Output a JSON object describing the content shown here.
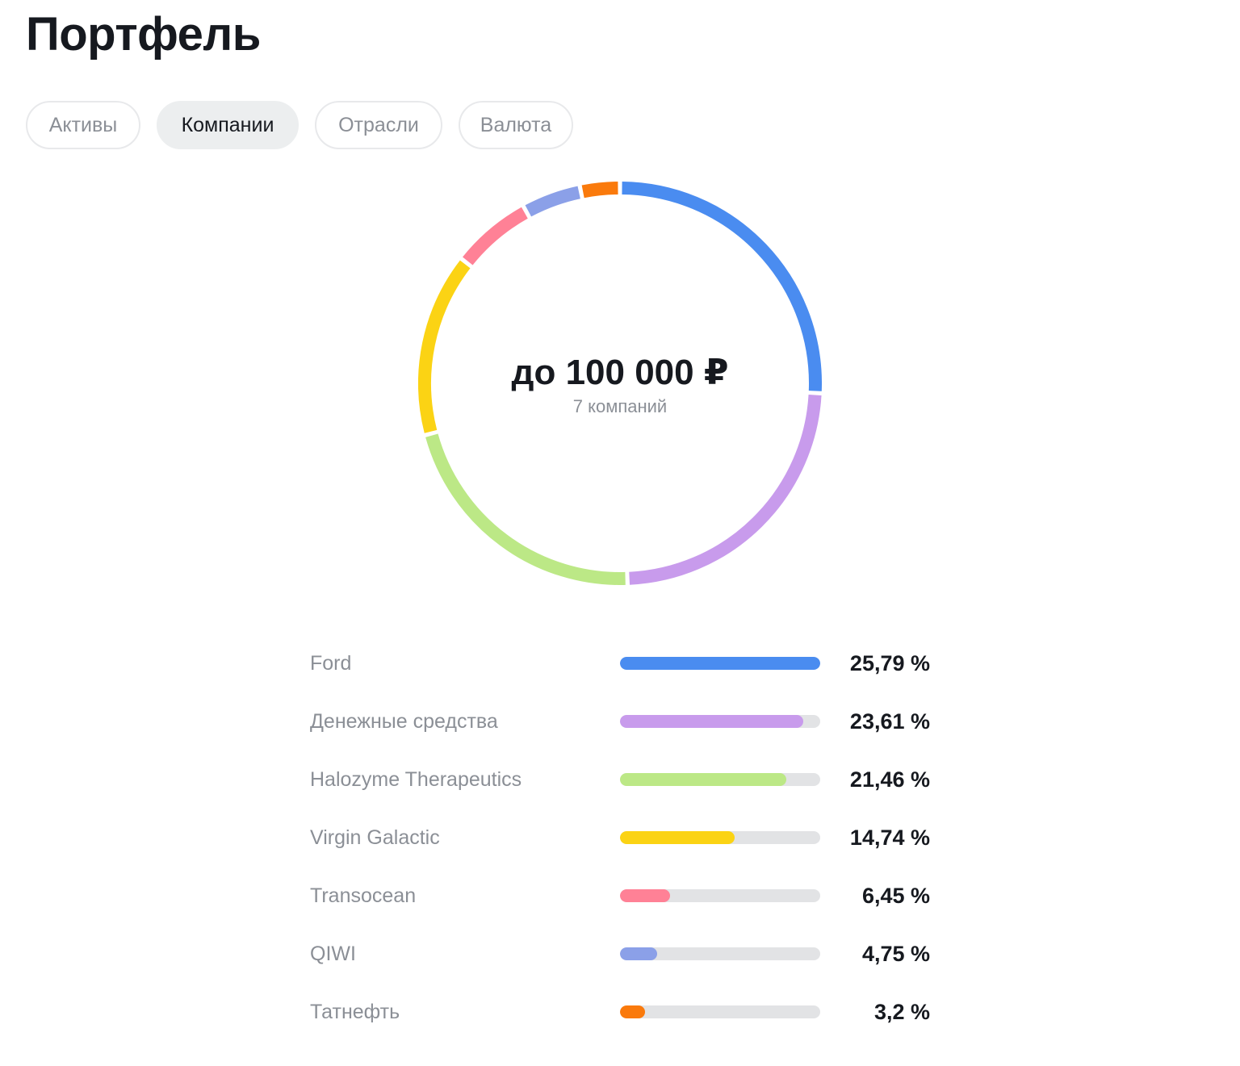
{
  "header": {
    "title": "Портфель"
  },
  "tabs": [
    {
      "label": "Активы",
      "active": false
    },
    {
      "label": "Компании",
      "active": true
    },
    {
      "label": "Отрасли",
      "active": false
    },
    {
      "label": "Валюта",
      "active": false
    }
  ],
  "summary": {
    "amount": "до 100 000 ₽",
    "subtitle": "7 компаний"
  },
  "chart_data": {
    "type": "pie",
    "series": [
      {
        "name": "Ford",
        "value": 25.79,
        "label": "25,79 %",
        "color": "#4a8cf0"
      },
      {
        "name": "Денежные средства",
        "value": 23.61,
        "label": "23,61 %",
        "color": "#c89bec"
      },
      {
        "name": "Halozyme Therapeutics",
        "value": 21.46,
        "label": "21,46 %",
        "color": "#bce886"
      },
      {
        "name": "Virgin Galactic",
        "value": 14.74,
        "label": "14,74 %",
        "color": "#fbd314"
      },
      {
        "name": "Transocean",
        "value": 6.45,
        "label": "6,45 %",
        "color": "#ff8196"
      },
      {
        "name": "QIWI",
        "value": 4.75,
        "label": "4,75 %",
        "color": "#8ba0e8"
      },
      {
        "name": "Татнефть",
        "value": 3.2,
        "label": "3,2 %",
        "color": "#fa7a0c"
      }
    ]
  }
}
